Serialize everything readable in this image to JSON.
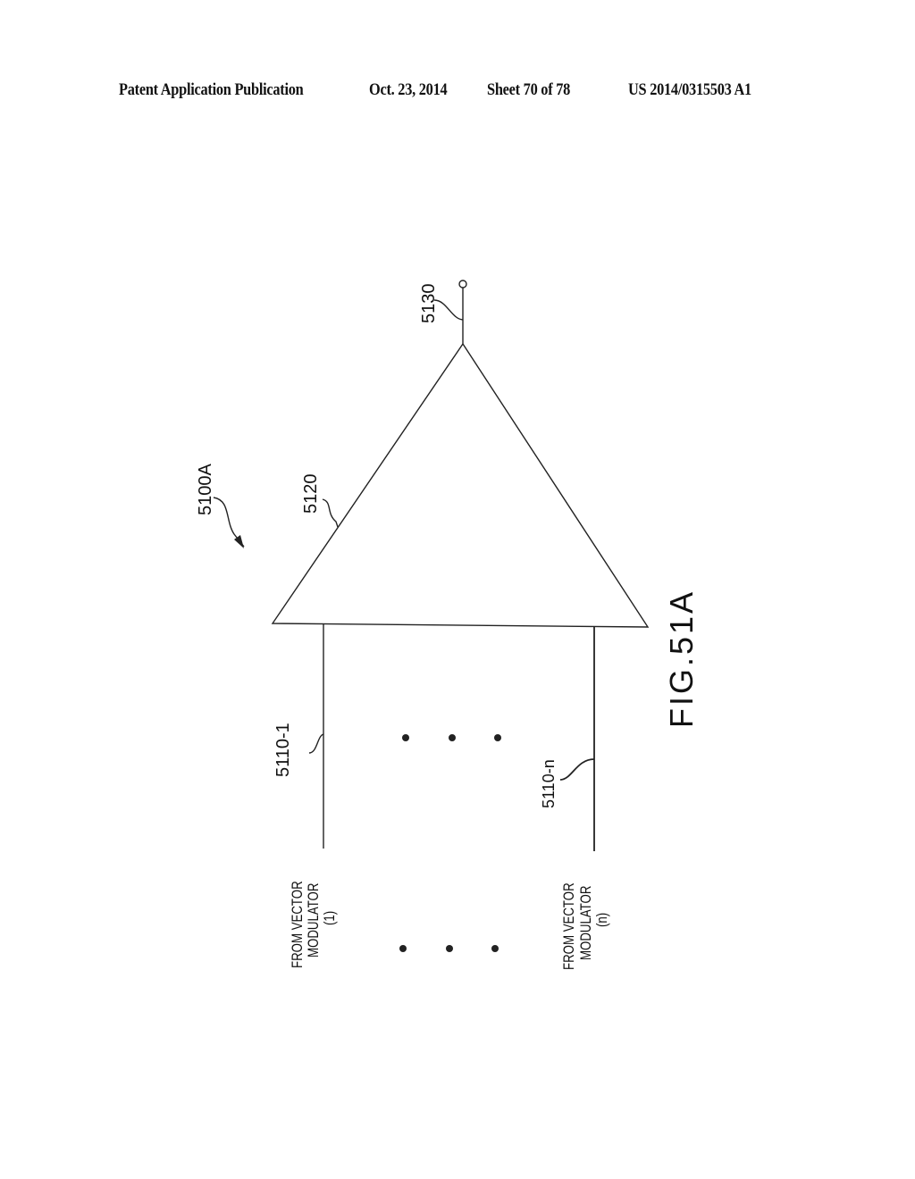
{
  "header": {
    "publication": "Patent Application Publication",
    "date": "Oct. 23, 2014",
    "sheet": "Sheet 70 of 78",
    "number": "US 2014/0315503 A1"
  },
  "figure": {
    "caption": "FIG.51A",
    "assembly_ref": "5100A",
    "amplifier_ref": "5120",
    "output_ref": "5130",
    "inputs": [
      {
        "ref": "5110-1",
        "source_line1": "FROM VECTOR",
        "source_line2": "MODULATOR",
        "source_line3": "(1)"
      },
      {
        "ref": "5110-n",
        "source_line1": "FROM VECTOR",
        "source_line2": "MODULATOR",
        "source_line3": "(n)"
      }
    ],
    "ellipsis_note": "three dots indicate additional inputs between 1 and n"
  }
}
